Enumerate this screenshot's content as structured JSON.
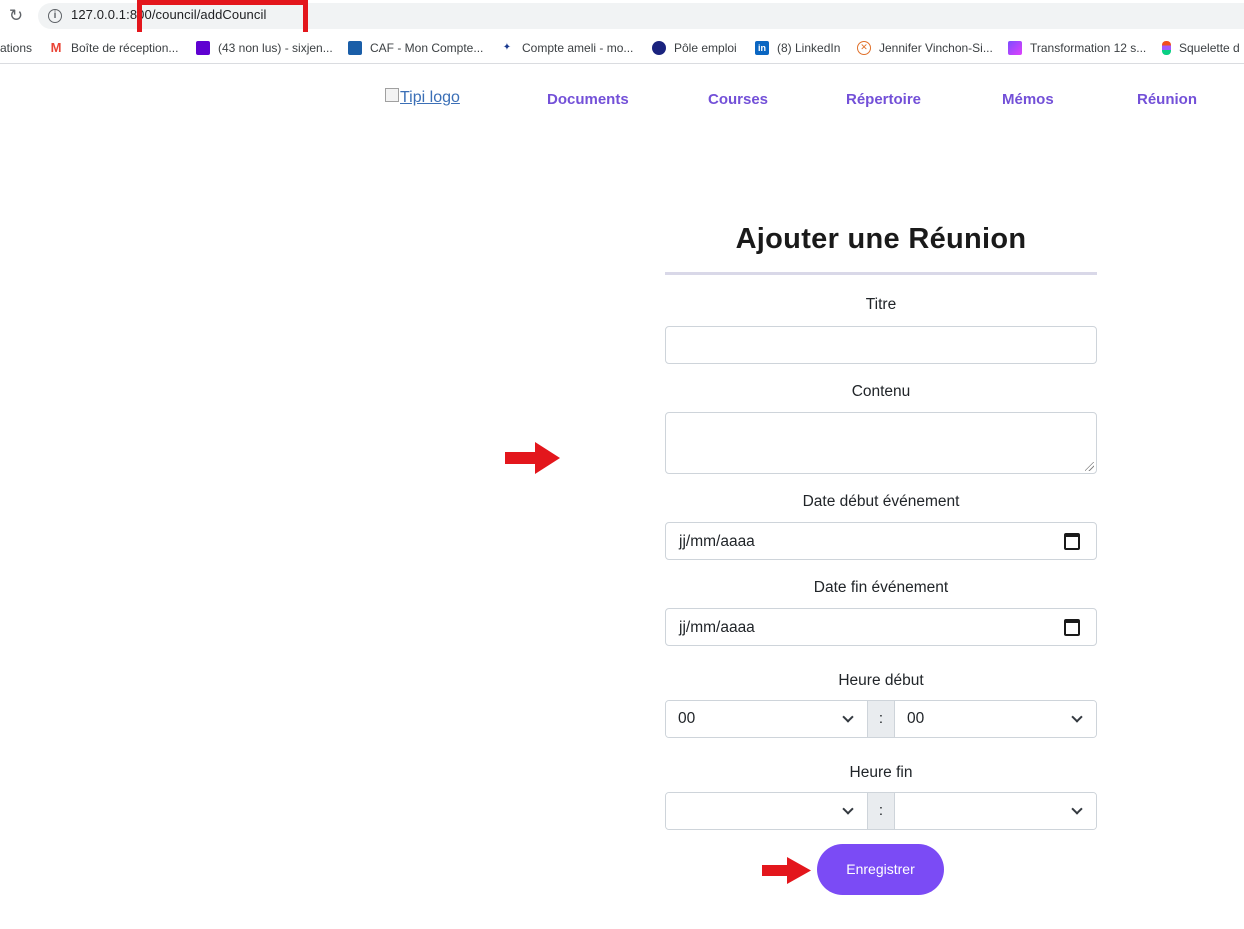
{
  "browser": {
    "url": "127.0.0.1:8000/council/addCouncil",
    "url_visible": "127.0.0.1:8",
    "url_visible_hidden": "00/council/addCouncil",
    "bookmarks": [
      {
        "label": "ations",
        "icon": "none"
      },
      {
        "label": "Boîte de réception...",
        "icon": "gmail-icon"
      },
      {
        "label": "(43 non lus) - sixjen...",
        "icon": "yahoo-mail-icon"
      },
      {
        "label": "CAF - Mon Compte...",
        "icon": "caf-icon"
      },
      {
        "label": "Compte ameli - mo...",
        "icon": "ameli-icon"
      },
      {
        "label": "Pôle emploi",
        "icon": "pole-emploi-icon"
      },
      {
        "label": "(8) LinkedIn",
        "icon": "linkedin-icon"
      },
      {
        "label": "Jennifer Vinchon-Si...",
        "icon": "site-icon"
      },
      {
        "label": "Transformation 12 s...",
        "icon": "transformation-icon"
      },
      {
        "label": "Squelette d",
        "icon": "figma-icon"
      }
    ]
  },
  "nav": {
    "logo_alt": "Tipi logo",
    "links": [
      "Documents",
      "Courses",
      "Répertoire",
      "Mémos",
      "Réunion"
    ]
  },
  "form": {
    "title": "Ajouter une Réunion",
    "titre_label": "Titre",
    "titre_value": "",
    "contenu_label": "Contenu",
    "contenu_value": "",
    "date_debut_label": "Date début événement",
    "date_debut_placeholder": "jj/mm/aaaa",
    "date_fin_label": "Date fin événement",
    "date_fin_placeholder": "jj/mm/aaaa",
    "heure_debut_label": "Heure début",
    "heure_debut_h": "00",
    "heure_debut_m": "00",
    "heure_fin_label": "Heure fin",
    "heure_fin_h": "",
    "heure_fin_m": "",
    "separator": ":",
    "submit_label": "Enregistrer"
  },
  "colors": {
    "accent": "#7b4bf5",
    "nav_link": "#7350d8",
    "annotation_red": "#e3161c"
  }
}
